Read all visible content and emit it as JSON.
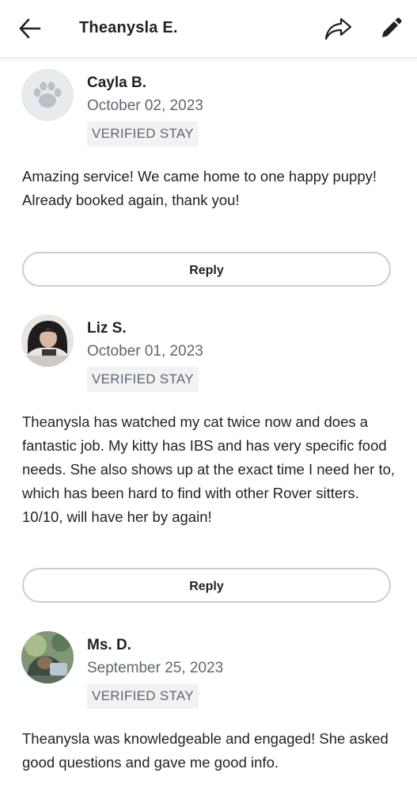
{
  "header": {
    "title": "Theanysla E.",
    "back_icon": "arrow-left-icon",
    "share_icon": "share-icon",
    "edit_icon": "pencil-icon"
  },
  "reviews": [
    {
      "name": "Cayla B.",
      "date": "October 02, 2023",
      "badge": "VERIFIED STAY",
      "text": "Amazing service! We came home to one happy puppy! Already booked again, thank you!",
      "reply_label": "Reply",
      "avatar": "paw-icon"
    },
    {
      "name": "Liz S.",
      "date": "October 01, 2023",
      "badge": "VERIFIED STAY",
      "text": "Theanysla has watched my cat twice now and does a fantastic job. My kitty has IBS and has very specific food needs. She also shows up at the exact time I need her to, which has been hard to find with other Rover sitters. 10/10, will have her by again!",
      "reply_label": "Reply",
      "avatar": "user-photo"
    },
    {
      "name": "Ms. D.",
      "date": "September 25, 2023",
      "badge": "VERIFIED STAY",
      "text": "Theanysla was knowledgeable and engaged! She asked good questions and gave me good info.",
      "avatar": "user-photo"
    }
  ],
  "colors": {
    "text": "#1f2124",
    "secondary": "#5f6670",
    "badge_bg": "#f1f2f4",
    "button_border": "#c9ced4"
  }
}
